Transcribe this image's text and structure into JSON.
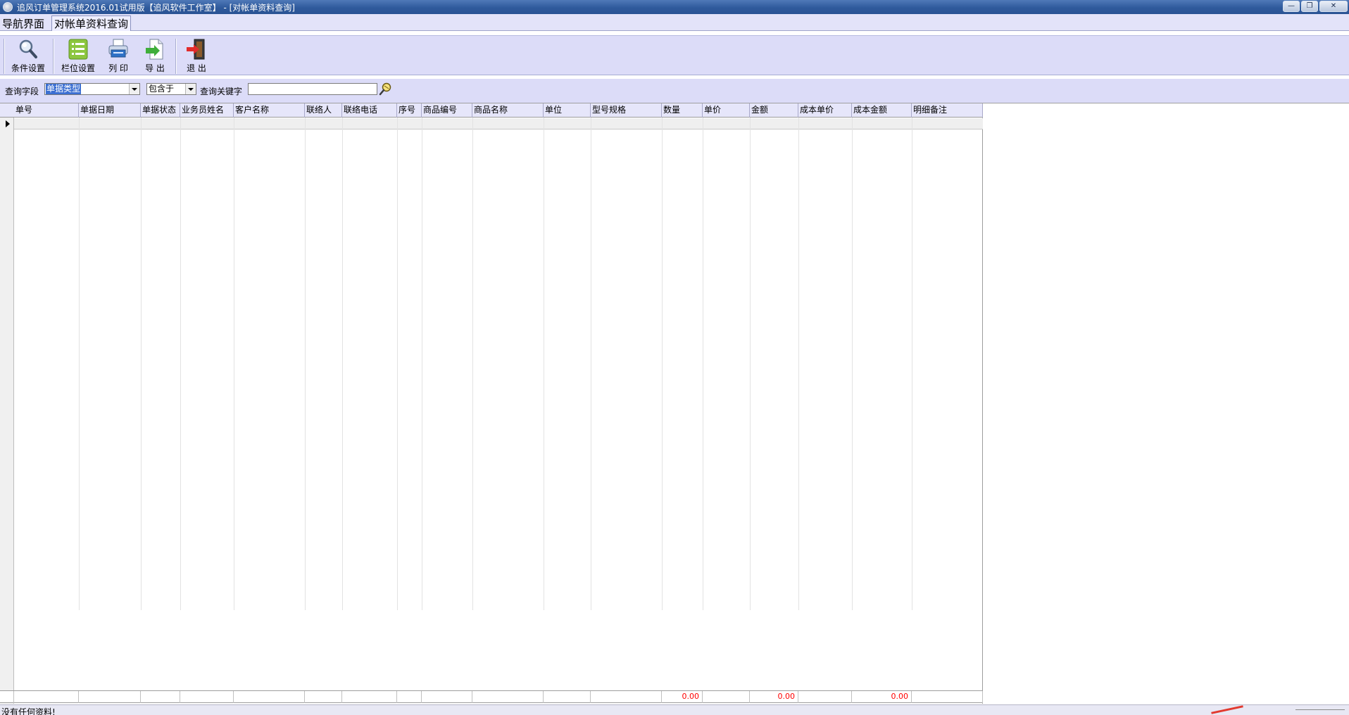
{
  "window": {
    "title": "追风订单管理系统2016.01试用版【追风软件工作室】 - [对帐单资料查询]",
    "minimize_glyph": "—",
    "restore_glyph": "❐",
    "close_glyph": "✕"
  },
  "tabs": [
    {
      "label": "导航界面",
      "active": false
    },
    {
      "label": "对帐单资料查询",
      "active": true
    }
  ],
  "toolbar": {
    "buttons": [
      {
        "label": "条件设置",
        "icon": "magnifier-icon"
      },
      {
        "label": "栏位设置",
        "icon": "list-icon"
      },
      {
        "label": "列 印",
        "icon": "printer-icon"
      },
      {
        "label": "导 出",
        "icon": "export-icon"
      },
      {
        "label": "退 出",
        "icon": "exit-door-icon"
      }
    ]
  },
  "query": {
    "field_label": "查询字段",
    "field_value": "单据类型",
    "operator_value": "包含于",
    "keyword_label": "查询关键字",
    "keyword_value": ""
  },
  "grid": {
    "columns": [
      "单号",
      "单据日期",
      "单据状态",
      "业务员姓名",
      "客户名称",
      "联络人",
      "联络电话",
      "序号",
      "商品编号",
      "商品名称",
      "单位",
      "型号规格",
      "数量",
      "单价",
      "金额",
      "成本单价",
      "成本金额",
      "明细备注"
    ],
    "rows": [],
    "totals": {
      "quantity": "0.00",
      "amount": "0.00",
      "cost_amount": "0.00"
    }
  },
  "status": {
    "message": "没有任何资料!"
  },
  "colors": {
    "title_bar": "#2f5a9c",
    "panel": "#dcdcf8",
    "header": "#e6e6fa",
    "totals_text": "#ff0000"
  }
}
